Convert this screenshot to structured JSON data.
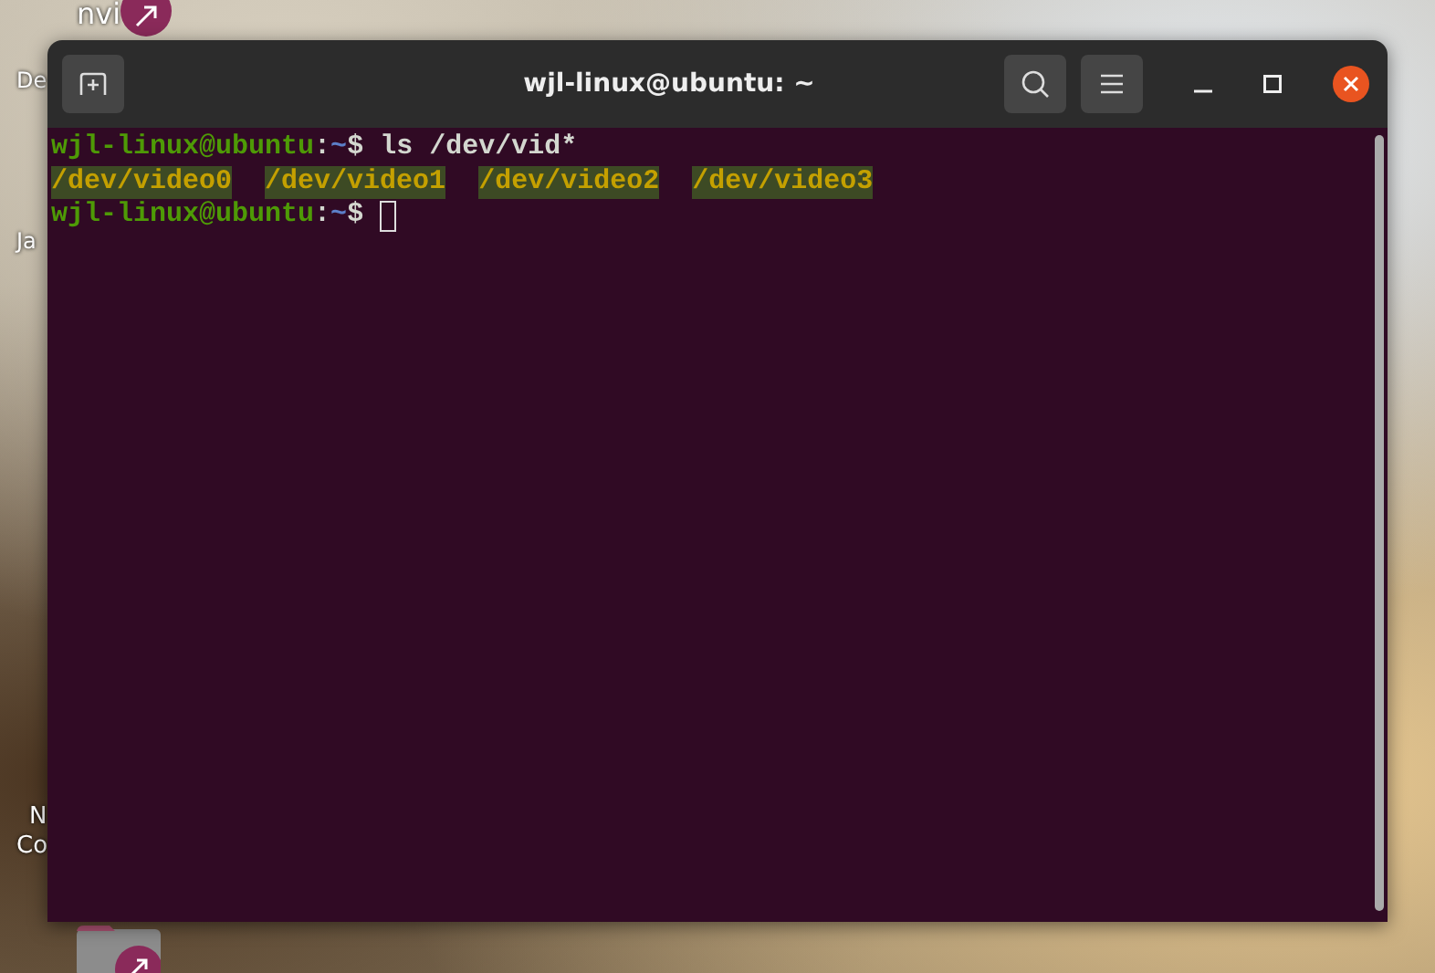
{
  "desktop": {
    "icon_labels": [
      {
        "text": "nvi"
      },
      {
        "text": "De"
      },
      {
        "text": "Ja"
      },
      {
        "text": "N"
      },
      {
        "text": "Co"
      }
    ]
  },
  "window": {
    "title": "wjl-linux@ubuntu: ~"
  },
  "terminal": {
    "lines": [
      {
        "kind": "prompt",
        "user_host": "wjl-linux@ubuntu",
        "separator": ":",
        "path": "~",
        "symbol": "$",
        "command": "ls /dev/vid*",
        "cursor": false
      },
      {
        "kind": "output",
        "entries": [
          "/dev/video0",
          "/dev/video1",
          "/dev/video2",
          "/dev/video3"
        ]
      },
      {
        "kind": "prompt",
        "user_host": "wjl-linux@ubuntu",
        "separator": ":",
        "path": "~",
        "symbol": "$",
        "cursor": true
      }
    ]
  }
}
